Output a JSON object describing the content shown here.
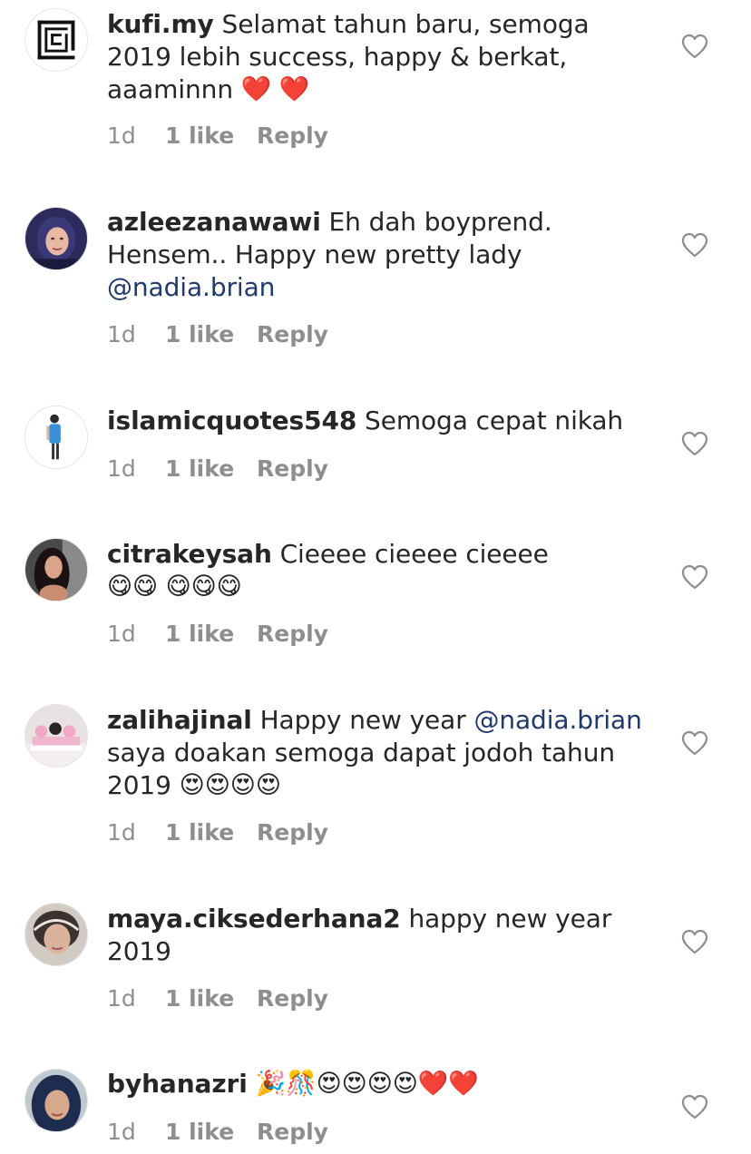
{
  "comments": [
    {
      "username": "kufi.my",
      "text": "Selamat tahun baru, semoga 2019 lebih success, happy & berkat, aaaminnn",
      "emojis": "❤️ ❤️",
      "time": "1d",
      "likes": "1 like",
      "reply": "Reply"
    },
    {
      "username": "azleezanawawi",
      "text": "Eh dah boyprend. Hensem.. Happy new pretty lady",
      "mention": "@nadia.brian",
      "time": "1d",
      "likes": "1 like",
      "reply": "Reply"
    },
    {
      "username": "islamicquotes548",
      "text": "Semoga cepat nikah",
      "time": "1d",
      "likes": "1 like",
      "reply": "Reply"
    },
    {
      "username": "citrakeysah",
      "text": "Cieeee cieeee cieeee",
      "emojis": "😋😋 😋😋😋",
      "time": "1d",
      "likes": "1 like",
      "reply": "Reply"
    },
    {
      "username": "zalihajinal",
      "text": "Happy new year",
      "mention": "@nadia.brian",
      "text2": "saya doakan semoga dapat jodoh tahun 2019",
      "emojis": "😍😍😍😍",
      "time": "1d",
      "likes": "1 like",
      "reply": "Reply"
    },
    {
      "username": "maya.ciksederhana2",
      "text": "happy new year 2019",
      "time": "1d",
      "likes": "1 like",
      "reply": "Reply"
    },
    {
      "username": "byhanazri",
      "emojis": "🎉🎊😍😍😍😍❤️❤️",
      "time": "1d",
      "likes": "1 like",
      "reply": "Reply"
    }
  ],
  "icons": {
    "like": "heart-outline-icon"
  },
  "colors": {
    "mention": "#1e3a6e",
    "meta": "#8e8e8e",
    "text": "#262626"
  }
}
